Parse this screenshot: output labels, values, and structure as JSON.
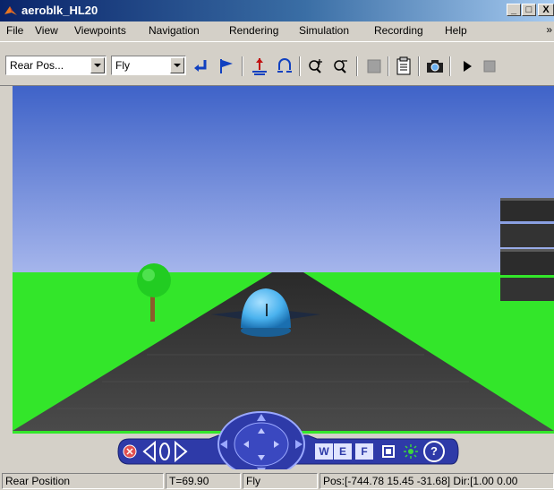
{
  "window": {
    "title": "aeroblk_HL20",
    "minimize": "_",
    "maximize": "□",
    "close": "X"
  },
  "menu": [
    "File",
    "View",
    "Viewpoints",
    "Navigation",
    "Rendering",
    "Simulation",
    "Recording",
    "Help"
  ],
  "toolbar": {
    "viewpoint_value": "Rear Pos...",
    "navigation_mode_value": "Fly",
    "icons": [
      "return-to-viewpoint-icon",
      "create-viewpoint-icon",
      "straighten-up-icon",
      "undo-move-icon",
      "zoom-in-icon",
      "zoom-out-icon",
      "record-icon",
      "parameters-icon",
      "snapshot-icon",
      "play-icon",
      "stop-icon"
    ]
  },
  "nav_panel": {
    "w_label": "W",
    "e_label": "E",
    "f_label": "F",
    "help_label": "?"
  },
  "status": {
    "viewpoint": "Rear Position",
    "time": "T=69.90",
    "mode": "Fly",
    "position": "Pos:[-744.78 15.45 -31.68] Dir:[1.00 0.00"
  },
  "colors": {
    "sky_top": "#3f63c8",
    "sky_bottom": "#a6b6ec",
    "ground": "#33e62a",
    "road": "#3c3c3c",
    "aircraft": "#4ab2ee",
    "tree": "#22cc22"
  }
}
